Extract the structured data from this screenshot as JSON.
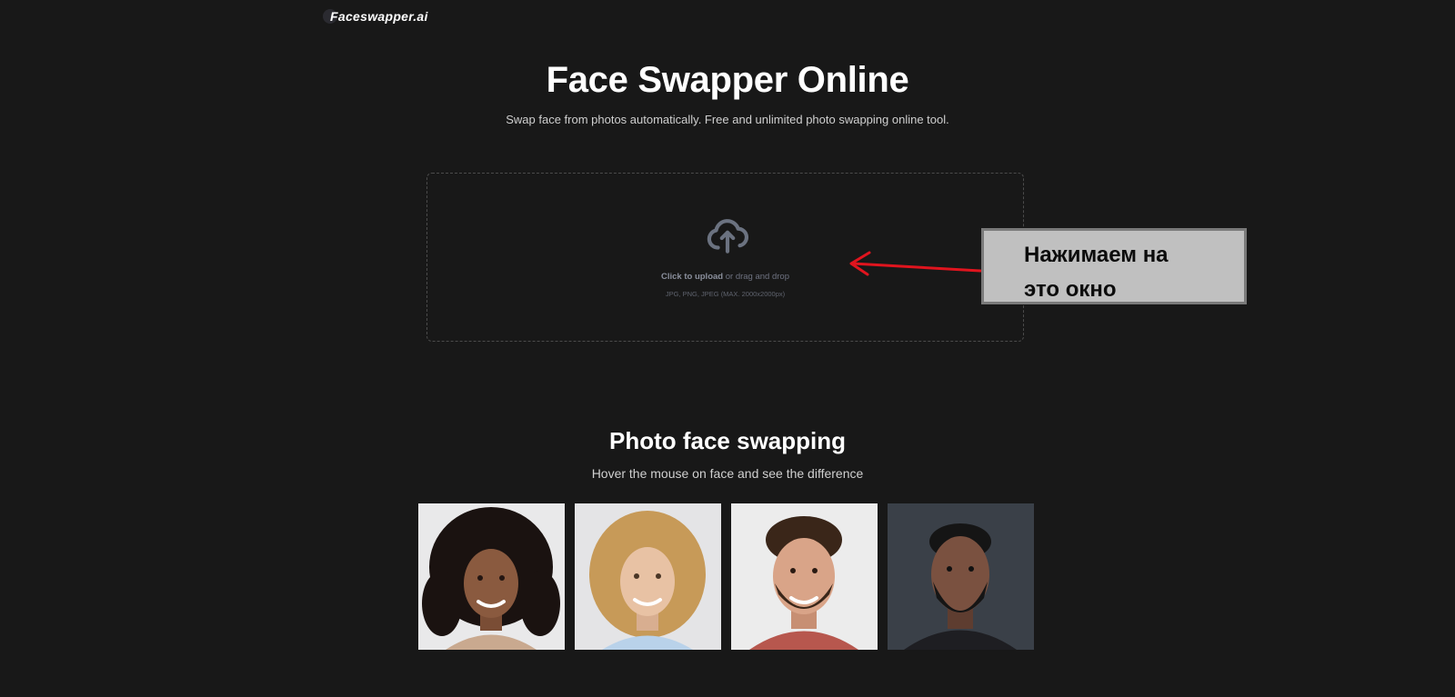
{
  "header": {
    "logo_text": "Faceswapper.ai"
  },
  "hero": {
    "title": "Face Swapper Online",
    "subtitle": "Swap face from photos automatically. Free and unlimited photo swapping online tool."
  },
  "upload": {
    "icon": "cloud-upload-icon",
    "click_label": "Click to upload",
    "drag_label": " or drag and drop",
    "formats_hint": "JPG, PNG, JPEG (MAX. 2000x2000px)"
  },
  "annotation": {
    "callout_line1": "Нажимаем на",
    "callout_line2": "это окно",
    "arrow_color": "#e0141e"
  },
  "gallery": {
    "title": "Photo face swapping",
    "subtitle": "Hover the mouse on face and see the difference",
    "photos": [
      {
        "background": "#e9e9ea",
        "hair": "#1a1210",
        "skin": "#8a5a3f",
        "shirt": "#c9a98f"
      },
      {
        "background": "#e4e4e6",
        "hair": "#c79a58",
        "skin": "#e8c2a4",
        "shirt": "#b9d2ea"
      },
      {
        "background": "#ececec",
        "hair": "#3a2619",
        "skin": "#d9a488",
        "shirt": "#b7574e"
      },
      {
        "background": "#3a4048",
        "hair": "#151515",
        "skin": "#7a5140",
        "shirt": "#1e1e22"
      }
    ]
  },
  "colors": {
    "background": "#181818",
    "dropzone_border": "#4b4b4b",
    "upload_icon": "#6b7280"
  }
}
